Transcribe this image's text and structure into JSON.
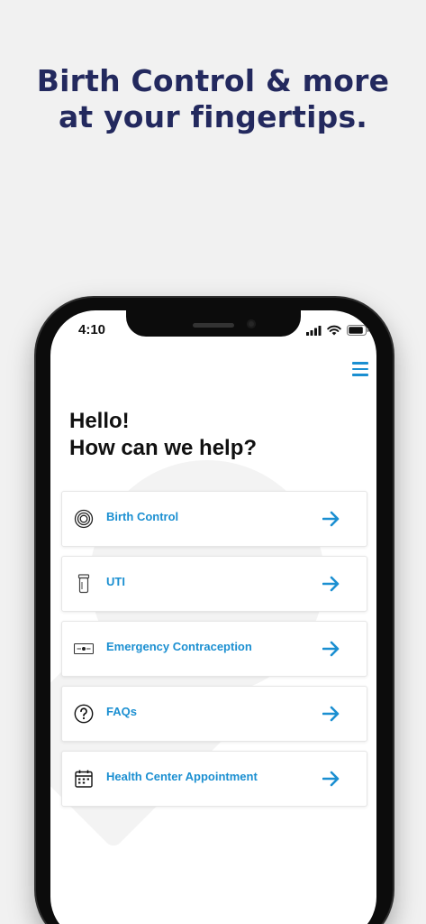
{
  "headline": {
    "line1": "Birth Control & more",
    "line2": "at your fingertips."
  },
  "status_bar": {
    "time": "4:10",
    "icons": [
      "cellular-signal-icon",
      "wifi-icon",
      "battery-icon"
    ]
  },
  "header": {
    "menu_icon": "hamburger-menu-icon"
  },
  "greeting": {
    "line1": "Hello!",
    "line2": "How can we help?"
  },
  "menu_items": [
    {
      "label": "Birth Control",
      "icon": "ring-icon"
    },
    {
      "label": "UTI",
      "icon": "pill-bottle-icon"
    },
    {
      "label": "Emergency Contraception",
      "icon": "pill-pack-icon"
    },
    {
      "label": "FAQs",
      "icon": "question-icon"
    },
    {
      "label": "Health Center Appointment",
      "icon": "calendar-icon"
    }
  ],
  "colors": {
    "headline": "#23295e",
    "accent": "#1b8fd1",
    "background": "#f1f1f1"
  }
}
